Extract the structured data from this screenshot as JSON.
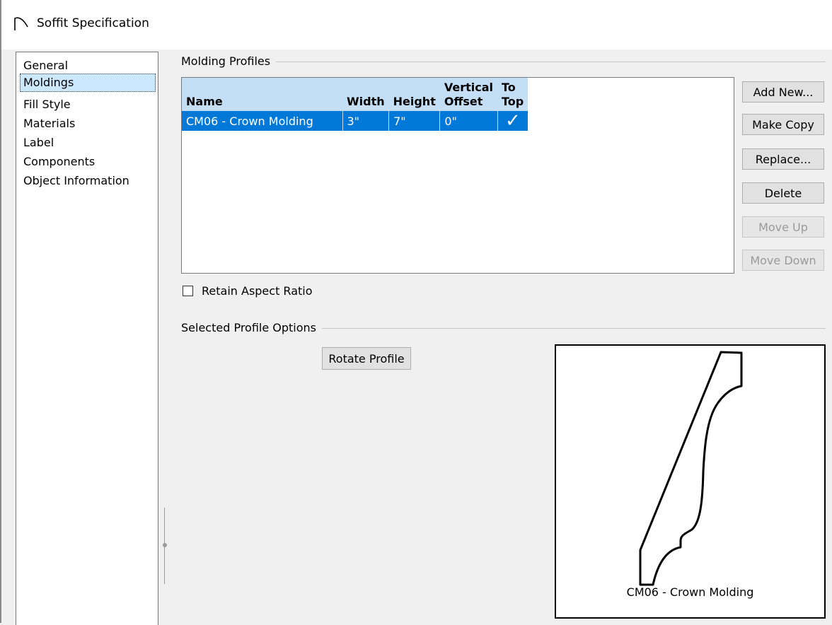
{
  "window": {
    "title": "Soffit Specification"
  },
  "sidebar": {
    "items": [
      {
        "label": "General"
      },
      {
        "label": "Moldings"
      },
      {
        "label": "Fill Style"
      },
      {
        "label": "Materials"
      },
      {
        "label": "Label"
      },
      {
        "label": "Components"
      },
      {
        "label": "Object Information"
      }
    ],
    "selected": "Moldings"
  },
  "molding_profiles": {
    "group_label": "Molding Profiles",
    "columns": {
      "name": "Name",
      "width": "Width",
      "height": "Height",
      "vertical_offset_line1": "Vertical",
      "vertical_offset_line2": "Offset",
      "to_top_line1": "To",
      "to_top_line2": "Top"
    },
    "rows": [
      {
        "name": "CM06 - Crown Molding",
        "width": "3\"",
        "height": "7\"",
        "vertical_offset": "0\"",
        "to_top": "✓"
      }
    ]
  },
  "buttons": {
    "add_new": "Add New...",
    "make_copy": "Make Copy",
    "replace": "Replace...",
    "delete": "Delete",
    "move_up": "Move Up",
    "move_down": "Move Down"
  },
  "retain_aspect_ratio": {
    "label": "Retain Aspect Ratio",
    "checked": false
  },
  "selected_profile_options": {
    "group_label": "Selected Profile Options",
    "rotate_button": "Rotate Profile"
  },
  "preview": {
    "caption": "CM06 - Crown Molding"
  }
}
